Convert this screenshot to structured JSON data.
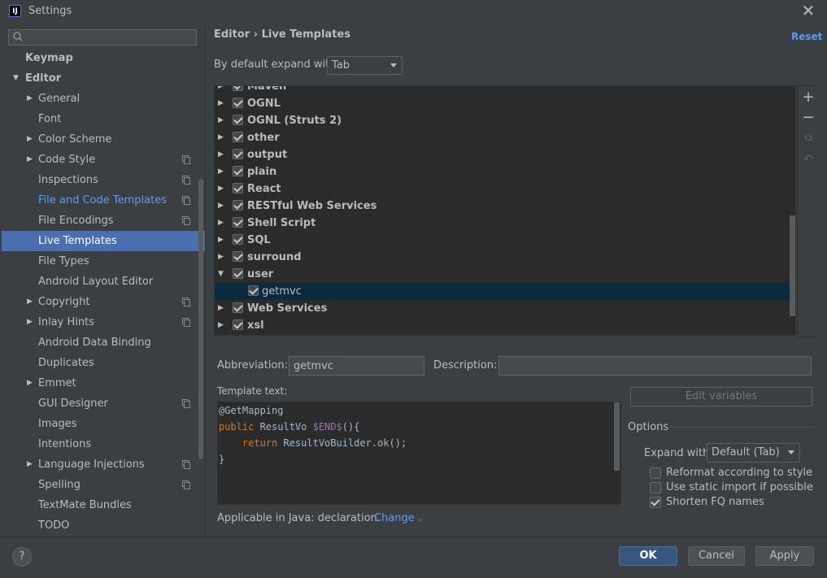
{
  "window": {
    "title": "Settings",
    "app_icon": "IJ",
    "close_glyph": "✕"
  },
  "sidebar": {
    "search_placeholder": "",
    "items": [
      {
        "label": "Keymap",
        "indent": 0,
        "bold": true,
        "arrow": "",
        "copy": false
      },
      {
        "label": "Editor",
        "indent": 0,
        "bold": true,
        "arrow": "▼",
        "copy": false
      },
      {
        "label": "General",
        "indent": 1,
        "arrow": "▶",
        "copy": false
      },
      {
        "label": "Font",
        "indent": 1,
        "arrow": "",
        "copy": false
      },
      {
        "label": "Color Scheme",
        "indent": 1,
        "arrow": "▶",
        "copy": false
      },
      {
        "label": "Code Style",
        "indent": 1,
        "arrow": "▶",
        "copy": true
      },
      {
        "label": "Inspections",
        "indent": 1,
        "arrow": "",
        "copy": true
      },
      {
        "label": "File and Code Templates",
        "indent": 1,
        "arrow": "",
        "copy": true,
        "link": true
      },
      {
        "label": "File Encodings",
        "indent": 1,
        "arrow": "",
        "copy": true
      },
      {
        "label": "Live Templates",
        "indent": 1,
        "arrow": "",
        "copy": false,
        "selected": true
      },
      {
        "label": "File Types",
        "indent": 1,
        "arrow": "",
        "copy": false
      },
      {
        "label": "Android Layout Editor",
        "indent": 1,
        "arrow": "",
        "copy": false
      },
      {
        "label": "Copyright",
        "indent": 1,
        "arrow": "▶",
        "copy": true
      },
      {
        "label": "Inlay Hints",
        "indent": 1,
        "arrow": "▶",
        "copy": true
      },
      {
        "label": "Android Data Binding",
        "indent": 1,
        "arrow": "",
        "copy": false
      },
      {
        "label": "Duplicates",
        "indent": 1,
        "arrow": "",
        "copy": false
      },
      {
        "label": "Emmet",
        "indent": 1,
        "arrow": "▶",
        "copy": false
      },
      {
        "label": "GUI Designer",
        "indent": 1,
        "arrow": "",
        "copy": true
      },
      {
        "label": "Images",
        "indent": 1,
        "arrow": "",
        "copy": false
      },
      {
        "label": "Intentions",
        "indent": 1,
        "arrow": "",
        "copy": false
      },
      {
        "label": "Language Injections",
        "indent": 1,
        "arrow": "▶",
        "copy": true
      },
      {
        "label": "Spelling",
        "indent": 1,
        "arrow": "",
        "copy": true
      },
      {
        "label": "TextMate Bundles",
        "indent": 1,
        "arrow": "",
        "copy": false
      },
      {
        "label": "TODO",
        "indent": 1,
        "arrow": "",
        "copy": false
      }
    ]
  },
  "header": {
    "breadcrumb": "Editor  ›  Live Templates",
    "reset": "Reset",
    "expand_label": "By default expand with",
    "expand_value": "Tab"
  },
  "tree": {
    "rows": [
      {
        "label": "Maven",
        "arrow": "▶",
        "partial": true
      },
      {
        "label": "OGNL",
        "arrow": "▶"
      },
      {
        "label": "OGNL (Struts 2)",
        "arrow": "▶"
      },
      {
        "label": "other",
        "arrow": "▶"
      },
      {
        "label": "output",
        "arrow": "▶"
      },
      {
        "label": "plain",
        "arrow": "▶"
      },
      {
        "label": "React",
        "arrow": "▶"
      },
      {
        "label": "RESTful Web Services",
        "arrow": "▶"
      },
      {
        "label": "Shell Script",
        "arrow": "▶"
      },
      {
        "label": "SQL",
        "arrow": "▶"
      },
      {
        "label": "surround",
        "arrow": "▶"
      },
      {
        "label": "user",
        "arrow": "▼"
      },
      {
        "label": "getmvc",
        "arrow": "",
        "child": true
      },
      {
        "label": "Web Services",
        "arrow": "▶"
      },
      {
        "label": "xsl",
        "arrow": "▶"
      }
    ],
    "toolbar": {
      "add": "+",
      "remove": "−",
      "copy": "⧉",
      "restore": "↶"
    }
  },
  "form": {
    "abbreviation_label": "Abbreviation:",
    "abbreviation_value": "getmvc",
    "description_label": "Description:",
    "description_value": "",
    "template_text_label": "Template text:",
    "edit_variables": "Edit variables",
    "options_label": "Options",
    "expand_with_label": "Expand with",
    "expand_with_value": "Default (Tab)",
    "opt_reformat": "Reformat according to style",
    "opt_static_import": "Use static import if possible",
    "opt_shorten": "Shorten FQ names",
    "applicable": "Applicable in Java: declaration.",
    "change": "Change"
  },
  "code": {
    "line1": "@GetMapping",
    "line2_kw": "public",
    "line2_a": " ResultVo ",
    "line2_var": "$END$",
    "line2_b": "(){",
    "line3_kw": "    return",
    "line3_a": " ResultVoBuilder.ok();",
    "line4": "}"
  },
  "footer": {
    "help": "?",
    "ok": "OK",
    "cancel": "Cancel",
    "apply": "Apply"
  }
}
